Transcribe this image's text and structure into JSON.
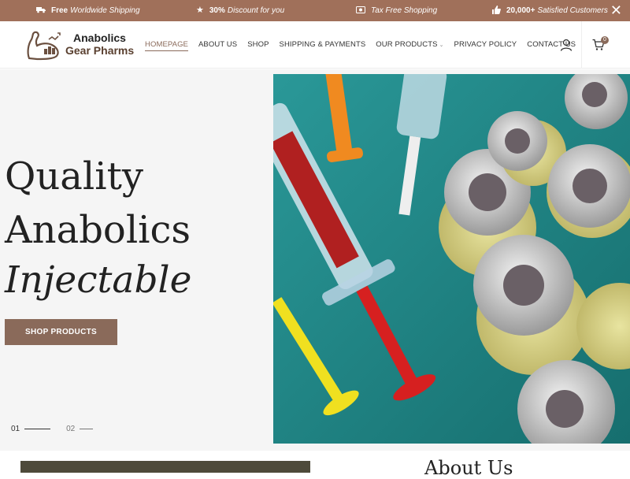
{
  "topbar": {
    "items": [
      {
        "icon": "truck-icon",
        "bold": "Free",
        "text": "Worldwide Shipping"
      },
      {
        "icon": "star-icon",
        "bold": "30%",
        "text": "Discount for you"
      },
      {
        "icon": "money-icon",
        "bold": "",
        "text": "Tax Free Shopping"
      },
      {
        "icon": "thumbs-up-icon",
        "bold": "20,000+",
        "text": "Satisfied Customers"
      }
    ],
    "close_icon": "close-icon"
  },
  "logo": {
    "line1": "Anabolics",
    "line2": "Gear Pharms"
  },
  "nav": {
    "items": [
      {
        "label": "HOMEPAGE"
      },
      {
        "label": "ABOUT US"
      },
      {
        "label": "SHOP"
      },
      {
        "label": "SHIPPING & PAYMENTS"
      },
      {
        "label": "OUR PRODUCTS"
      },
      {
        "label": "PRIVACY POLICY"
      },
      {
        "label": "CONTACT US"
      }
    ],
    "cart_count": "0"
  },
  "hero": {
    "line1": "Quality",
    "line2": "Anabolics",
    "line3": "Injectable",
    "button": "SHOP PRODUCTS",
    "slide1": "01",
    "slide2": "02"
  },
  "about": {
    "title": "About Us"
  },
  "colors": {
    "brand": "#a0705a",
    "button": "#8a6a5a",
    "teal": "#1f8a8a"
  }
}
